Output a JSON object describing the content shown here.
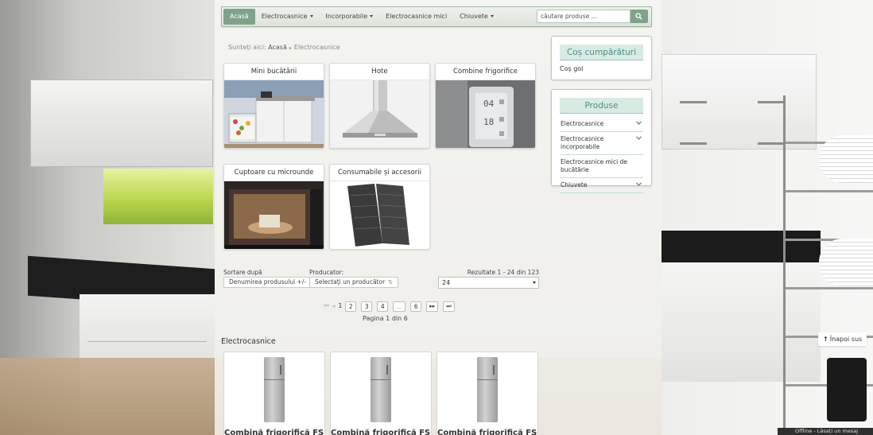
{
  "nav": {
    "items": [
      {
        "label": "Acasă",
        "active": true,
        "dropdown": false
      },
      {
        "label": "Electrocasnice",
        "active": false,
        "dropdown": true
      },
      {
        "label": "Incorporabile",
        "active": false,
        "dropdown": true
      },
      {
        "label": "Electrocasnice mici",
        "active": false,
        "dropdown": false
      },
      {
        "label": "Chiuvete",
        "active": false,
        "dropdown": true
      }
    ],
    "search_placeholder": "căutare produse ...",
    "accent_color": "#7fa38a"
  },
  "breadcrumb": {
    "prefix": "Sunteți aici:",
    "home": "Acasă",
    "separator": "▸",
    "current": "Electrocasnice"
  },
  "categories": [
    {
      "title": "Mini bucătării",
      "icon": "mini-kitchen-image"
    },
    {
      "title": "Hote",
      "icon": "cooker-hood-image"
    },
    {
      "title": "Combine frigorifice",
      "icon": "fridge-panel-image"
    },
    {
      "title": "Cuptoare cu microunde",
      "icon": "microwave-image"
    },
    {
      "title": "Consumabile și accesorii",
      "icon": "filters-image"
    }
  ],
  "cart": {
    "title": "Coș cumpărături",
    "empty_text": "Coș gol"
  },
  "products_box": {
    "title": "Produse",
    "items": [
      {
        "label": "Electrocasnice",
        "expandable": true
      },
      {
        "label": "Electrocasnice incorporabile",
        "expandable": true
      },
      {
        "label": "Electrocasnice mici de bucătărie",
        "expandable": false
      },
      {
        "label": "Chiuvete",
        "expandable": true
      }
    ]
  },
  "sorting": {
    "sort_label": "Sortare după",
    "sort_value": "Denumirea produsului +/-",
    "producer_label": "Producator:",
    "producer_value": "Selectați un producător",
    "results_text": "Rezultate 1 - 24 din 123",
    "per_page": "24"
  },
  "pagination": {
    "current": "1",
    "pages": [
      "2",
      "3",
      "4",
      "...",
      "6"
    ],
    "info": "Pagina 1 din 6"
  },
  "listing": {
    "section_title": "Electrocasnice",
    "products": [
      {
        "name": "Combină frigorifică FSF"
      },
      {
        "name": "Combină frigorifică FSF"
      },
      {
        "name": "Combină frigorifică FSG"
      }
    ]
  },
  "back_to_top": "Înapoi sus",
  "offline_badge": "Offline - Lăsați un mesaj"
}
